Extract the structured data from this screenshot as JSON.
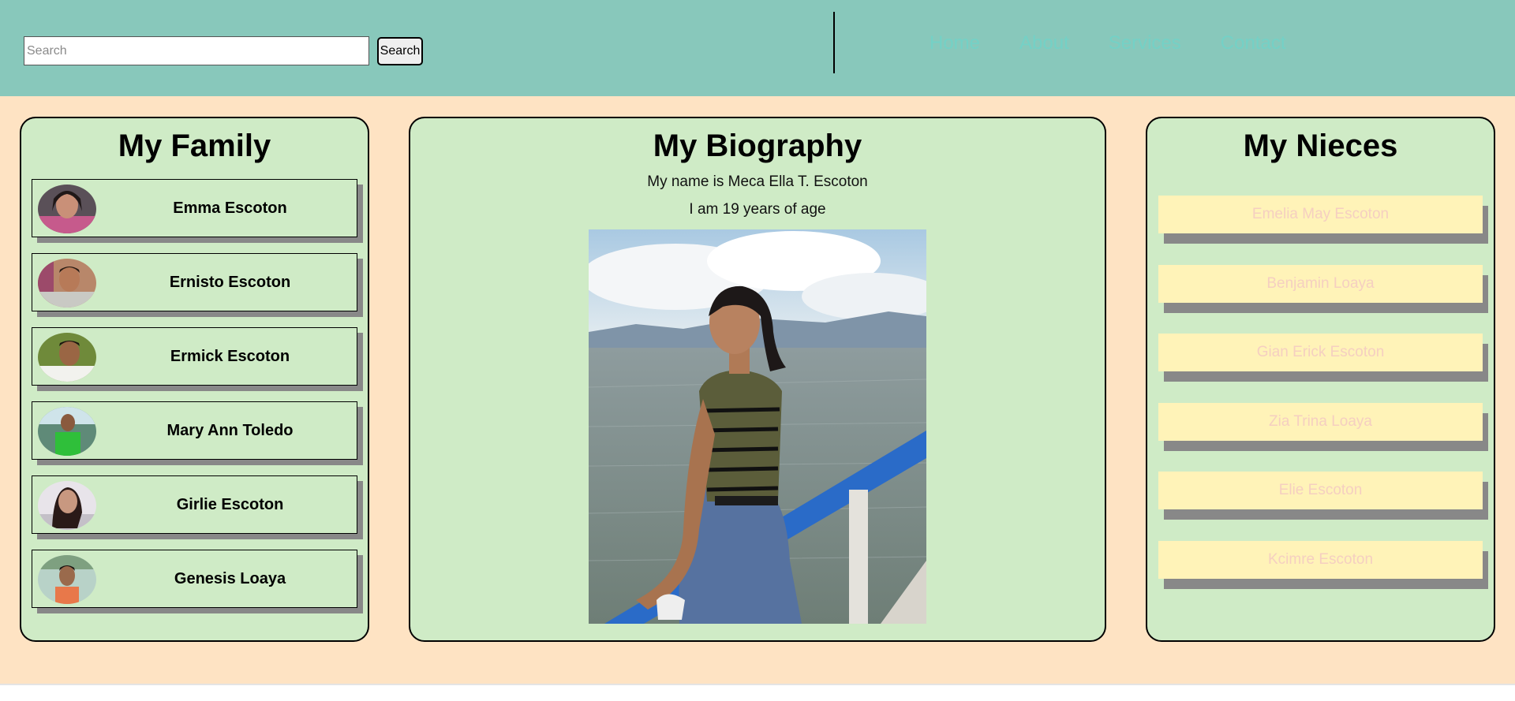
{
  "header": {
    "search": {
      "placeholder": "Search",
      "value": "",
      "button_label": "Search"
    },
    "nav": [
      "Home",
      "About",
      "Services",
      "Contact"
    ]
  },
  "family": {
    "title": "My Family",
    "members": [
      {
        "name": "Emma Escoton"
      },
      {
        "name": "Ernisto Escoton"
      },
      {
        "name": "Ermick Escoton"
      },
      {
        "name": "Mary Ann Toledo"
      },
      {
        "name": "Girlie Escoton"
      },
      {
        "name": "Genesis Loaya"
      }
    ]
  },
  "biography": {
    "title": "My Biography",
    "name_line": "My name is Meca Ella T. Escoton",
    "age_line": "I am 19 years of age"
  },
  "nieces": {
    "title": "My Nieces",
    "items": [
      "Emelia May Escoton",
      "Benjamin Loaya",
      "Gian Erick Escoton",
      "Zia Trina Loaya",
      "Elie Escoton",
      "Kcimre Escoton"
    ]
  },
  "colors": {
    "header_bg": "#88c8bb",
    "page_bg": "#fee3c3",
    "panel_bg": "#cfebc6",
    "nav_link": "#74d1c6",
    "niece_card_bg": "#fff3b8",
    "niece_text": "#f5cfc1",
    "shadow": "#888888"
  }
}
